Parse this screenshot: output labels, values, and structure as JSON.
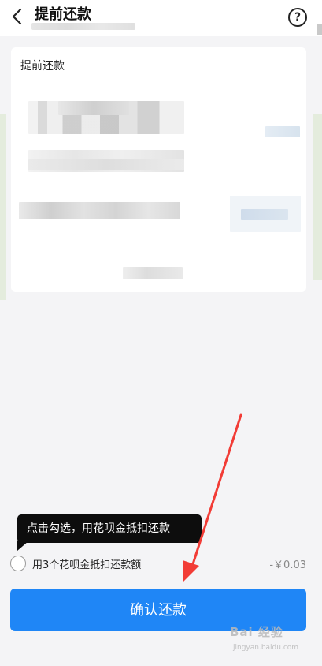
{
  "header": {
    "title": "提前还款",
    "help_icon": "?"
  },
  "card": {
    "title": "提前还款"
  },
  "tooltip": {
    "text": "点击勾选，用花呗金抵扣还款"
  },
  "option": {
    "label": "用3个花呗金抵扣还款额",
    "amount": "-￥0.03",
    "checked": false
  },
  "confirm": {
    "label": "确认还款",
    "color": "#1f86f6"
  },
  "watermark": {
    "brand": "Bai 经验",
    "url": "jingyan.baidu.com"
  },
  "annotation": {
    "arrow_color": "#f23c36",
    "arrow_icon": "red-arrow-icon"
  }
}
